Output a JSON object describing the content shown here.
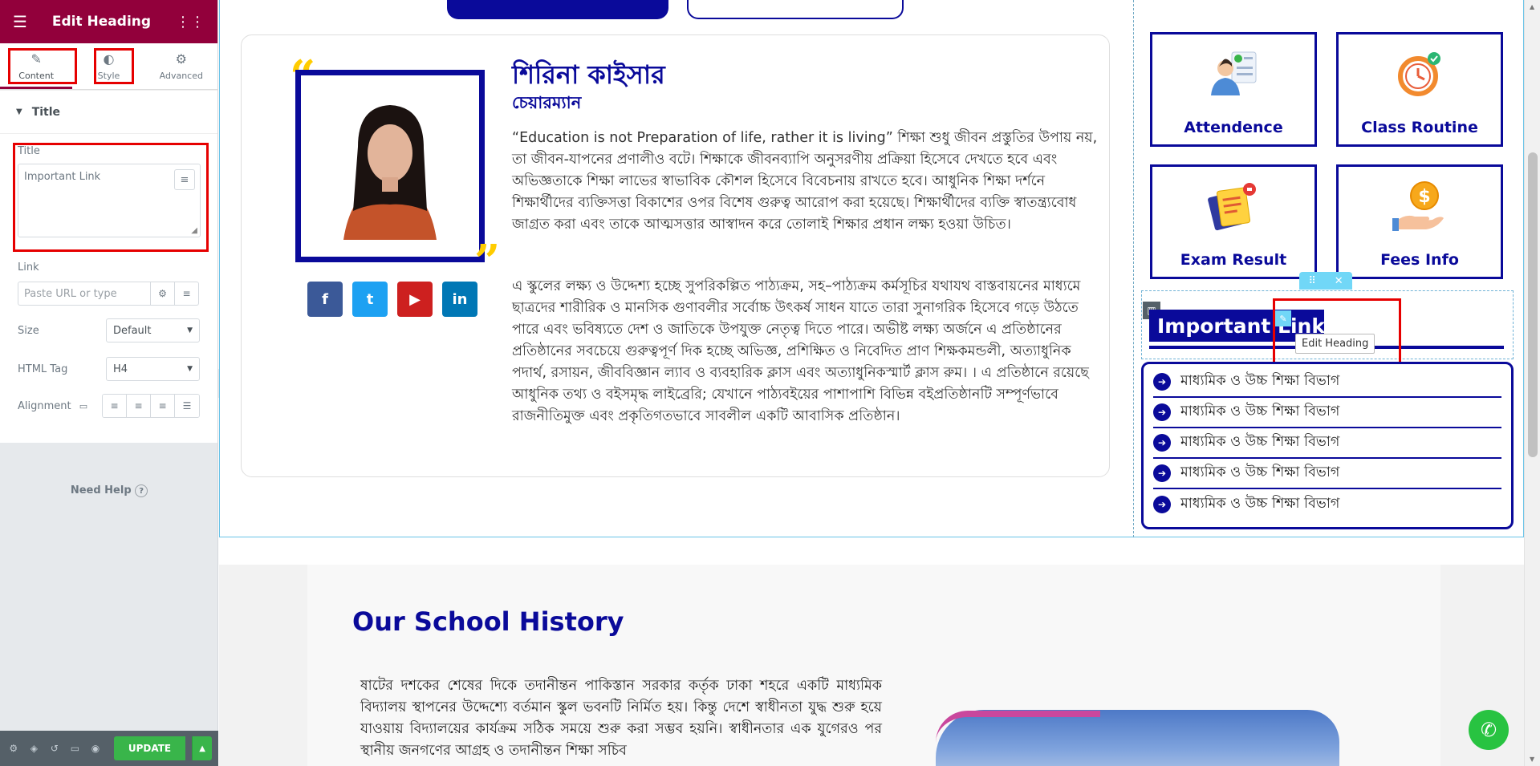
{
  "panel": {
    "title": "Edit Heading",
    "tabs": [
      {
        "label": "Content"
      },
      {
        "label": "Style"
      },
      {
        "label": "Advanced"
      }
    ],
    "section_title": "Title",
    "title_label": "Title",
    "title_value": "Important Link",
    "link_label": "Link",
    "link_placeholder": "Paste URL or type",
    "size_label": "Size",
    "size_value": "Default",
    "html_tag_label": "HTML Tag",
    "html_tag_value": "H4",
    "alignment_label": "Alignment",
    "need_help": "Need Help",
    "update_label": "UPDATE"
  },
  "profile": {
    "name": "শিরিনা কাইসার",
    "role": "চেয়ারম্যান",
    "para1": "“Education is not Preparation of life, rather it is living” শিক্ষা শুধু জীবন প্রস্তুতির উপায় নয়, তা জীবন-যাপনের প্রণালীও বটে। শিক্ষাকে জীবনব্যাপি অনুসরণীয় প্রক্রিয়া হিসেবে দেখতে হবে এবং অভিজ্ঞতাকে শিক্ষা লাভের স্বাভাবিক কৌশল হিসেবে বিবেচনায় রাখতে হবে। আধুনিক শিক্ষা দর্শনে শিক্ষার্থীদের ব্যক্তিসত্তা বিকাশের ওপর বিশেষ গুরুত্ব আরোপ করা হয়েছে। শিক্ষার্থীদের ব্যক্তি স্বাতন্ত্র্যবোধ জাগ্রত করা এবং তাকে আত্মসত্তার আস্বাদন করে তোলাই শিক্ষার প্রধান লক্ষ্য হওয়া উচিত।",
    "para2": "এ স্কুলের লক্ষ্য ও উদ্দেশ্য হচ্ছে সুপরিকল্পিত পাঠ্যক্রম, সহ–পাঠ্যক্রম কর্মসূচির যথাযথ বাস্তবায়নের মাধ্যমে ছাত্রদের শারীরিক ও মানসিক গুণাবলীর সর্বোচ্চ উৎকর্ষ সাধন যাতে তারা সুনাগরিক হিসেবে গড়ে উঠতে পারে এবং ভবিষ্যতে দেশ ও জাতিকে উপযুক্ত নেতৃত্ব দিতে পারে। অভীষ্ট লক্ষ্য অর্জনে এ প্রতিষ্ঠানের প্রতিষ্ঠানের সবচেয়ে গুরুত্বপূর্ণ দিক হচ্ছে অভিজ্ঞ, প্রশিক্ষিত ও নিবেদিত প্রাণ শিক্ষকমন্ডলী, অত্যাধুনিক পদার্থ, রসায়ন, জীববিজ্ঞান ল্যাব ও ব্যবহারিক ক্লাস এবং অত্যাধুনিকস্মার্ট ক্লাস রুম। । এ প্রতিষ্ঠানে রয়েছে আধুনিক তথ্য ও বইসমৃদ্ধ লাইব্রেরি; যেখানে পাঠ্যবইয়ের পাশাপাশি বিভিন্ন বইপ্রতিষ্ঠানটি সম্পূর্ণভাবে রাজনীতিমুক্ত এবং প্রকৃতিগতভাবে সাবলীল একটি আবাসিক প্রতিষ্ঠান।",
    "socials": [
      {
        "icon": "facebook-icon",
        "glyph": "f",
        "color": "#3b5998"
      },
      {
        "icon": "twitter-icon",
        "glyph": "t",
        "color": "#1da1f2"
      },
      {
        "icon": "youtube-icon",
        "glyph": "▶",
        "color": "#cd201f"
      },
      {
        "icon": "linkedin-icon",
        "glyph": "in",
        "color": "#0077b5"
      }
    ]
  },
  "tiles": [
    {
      "label": "Attendence",
      "icon": "attendance-icon"
    },
    {
      "label": "Class Routine",
      "icon": "clock-icon"
    },
    {
      "label": "Exam Result",
      "icon": "exam-result-icon"
    },
    {
      "label": "Fees Info",
      "icon": "fees-icon"
    }
  ],
  "important_link": {
    "heading": "Important Link",
    "tooltip": "Edit Heading",
    "items": [
      "মাধ্যমিক ও উচ্চ শিক্ষা বিভাগ",
      "মাধ্যমিক ও উচ্চ শিক্ষা বিভাগ",
      "মাধ্যমিক ও উচ্চ শিক্ষা বিভাগ",
      "মাধ্যমিক ও উচ্চ শিক্ষা বিভাগ",
      "মাধ্যমিক ও উচ্চ শিক্ষা বিভাগ"
    ]
  },
  "history": {
    "title": "Our School History",
    "text": "ষাটের দশকের শেষের দিকে তদানীন্তন পাকিস্তান সরকার কর্তৃক ঢাকা শহরে একটি মাধ্যমিক বিদ্যালয় স্থাপনের উদ্দেশ্যে বর্তমান স্কুল ভবনটি নির্মিত হয়। কিন্তু দেশে স্বাধীনতা যুদ্ধ শুরু হয়ে যাওয়ায় বিদ্যালয়ের কার্যক্রম সঠিক সময়ে শুরু করা সম্ভব হয়নি। স্বাধীনতার এক যুগেরও পর স্থানীয় জনগণের আগ্রহ ও তদানীন্তন শিক্ষা সচিব"
  },
  "colors": {
    "brand": "#0a0a9a",
    "editor": "#92003b",
    "accent": "#ffcc00",
    "update": "#39b54a"
  }
}
